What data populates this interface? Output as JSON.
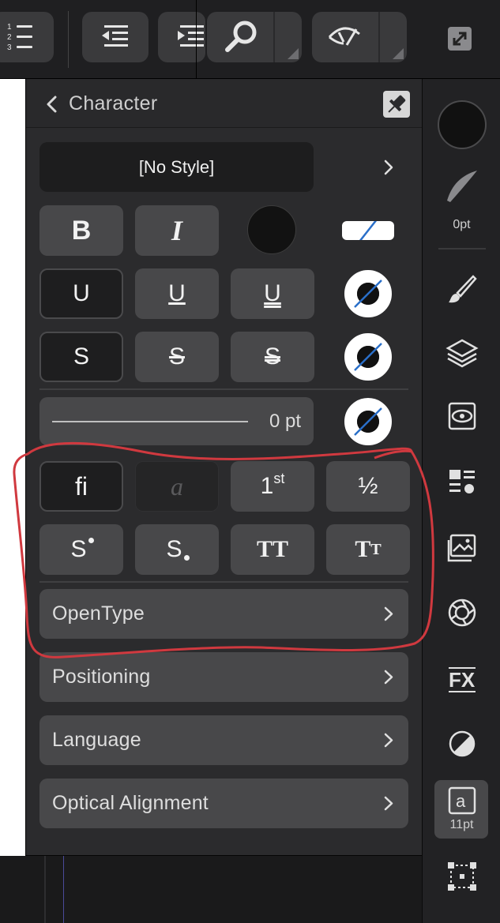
{
  "panel": {
    "title": "Character",
    "style_value": "[No Style]",
    "stroke_value": "0 pt"
  },
  "buttons": {
    "bold": "B",
    "italic": "I",
    "underline": "U",
    "underline_double": "U",
    "underline_triple": "U",
    "strike_s": "S",
    "strike_single": "S",
    "strike_double": "S",
    "ligature": "fi",
    "swash": "a",
    "ordinal_base": "1",
    "ordinal_sup": "st",
    "fraction": "½",
    "superscript": "S",
    "subscript": "S",
    "all_caps": "TT",
    "small_caps_big": "T",
    "small_caps_small": "T"
  },
  "sections": [
    "OpenType",
    "Positioning",
    "Language",
    "Optical Alignment"
  ],
  "studio": {
    "stroke_width": "0pt",
    "font_size": "11pt"
  },
  "icons": [
    "numbered-list-icon",
    "decrease-indent-icon",
    "increase-indent-icon",
    "zoom-icon",
    "view-mode-icon",
    "fullscreen-icon",
    "back-chevron-icon",
    "pin-icon",
    "brush-icon",
    "layers-icon",
    "appearance-icon",
    "text-styles-icon",
    "stock-icon",
    "color-wheel-icon",
    "fx-icon",
    "adjustment-icon",
    "character-icon",
    "transform-icon"
  ],
  "colors": {
    "panel_bg": "#2b2b2d",
    "button_bg": "#48484a",
    "annotation_red": "#d0393f",
    "stroke_accent": "#2a6fc9"
  }
}
